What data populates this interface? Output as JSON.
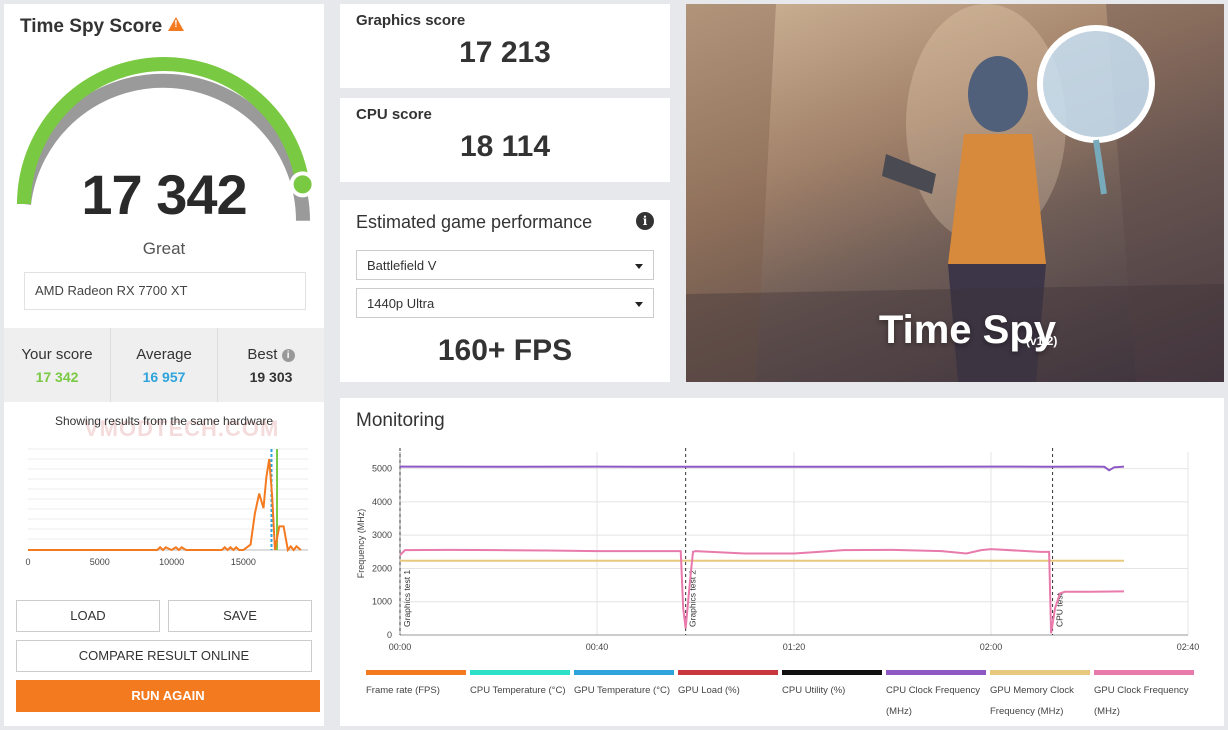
{
  "left": {
    "title": "Time Spy Score",
    "score": "17 342",
    "rating": "Great",
    "gpu_name": "AMD Radeon RX 7700 XT",
    "gauge_fraction": 0.92,
    "stats": {
      "your_label": "Your score",
      "your_value": "17 342",
      "avg_label": "Average",
      "avg_value": "16 957",
      "best_label": "Best",
      "best_value": "19 303"
    },
    "showing_text": "Showing results from the same hardware",
    "watermark": "VMODTECH.COM",
    "buttons": {
      "load": "LOAD",
      "save": "SAVE",
      "compare": "COMPARE RESULT ONLINE",
      "run": "RUN AGAIN"
    },
    "colors": {
      "green": "#7ac943",
      "blue": "#2ea3dc",
      "orange": "#f47a20"
    }
  },
  "graphics": {
    "label": "Graphics score",
    "value": "17 213"
  },
  "cpu": {
    "label": "CPU score",
    "value": "18 114"
  },
  "estimate": {
    "title": "Estimated game performance",
    "game": "Battlefield V",
    "preset": "1440p Ultra",
    "fps": "160+ FPS"
  },
  "hero": {
    "title": "Time Spy",
    "version": "(v1.2)"
  },
  "monitoring": {
    "title": "Monitoring",
    "legend": [
      {
        "label": "Frame rate (FPS)",
        "color": "#f47a20"
      },
      {
        "label": "CPU Temperature (°C)",
        "color": "#2fe0c8"
      },
      {
        "label": "GPU Temperature (°C)",
        "color": "#2ea3dc"
      },
      {
        "label": "GPU Load (%)",
        "color": "#c8383c"
      },
      {
        "label": "CPU Utility (%)",
        "color": "#111111"
      },
      {
        "label": "CPU Clock Frequency (MHz)",
        "color": "#8e58c4"
      },
      {
        "label": "GPU Memory Clock Frequency (MHz)",
        "color": "#e8c87c"
      },
      {
        "label": "GPU Clock Frequency (MHz)",
        "color": "#e87aac"
      }
    ]
  },
  "chart_data": [
    {
      "type": "line",
      "title": "",
      "xlabel": "",
      "ylabel": "",
      "xlim": [
        0,
        19500
      ],
      "x_ticks": [
        "0",
        "5000",
        "10000",
        "15000"
      ],
      "series": [
        {
          "x": [
            0,
            9000,
            9200,
            9400,
            9600,
            10000,
            10300,
            10500,
            10700,
            11000,
            13500,
            13700,
            13900,
            14100,
            14300,
            14500,
            14700,
            15000,
            15500,
            15800,
            16100,
            16400,
            16600,
            16800,
            17000,
            17200,
            17500,
            17800,
            18100,
            18300,
            18500,
            18700,
            19000
          ],
          "y": [
            0,
            0,
            3,
            0,
            3,
            0,
            3,
            0,
            3,
            0,
            0,
            3,
            0,
            3,
            0,
            3,
            0,
            0,
            6,
            40,
            62,
            46,
            80,
            100,
            60,
            0,
            26,
            26,
            0,
            4,
            0,
            4,
            0
          ]
        }
      ],
      "markers": [
        {
          "name": "Your score",
          "x": 17342,
          "color": "#7ac943"
        },
        {
          "name": "Average",
          "x": 16957,
          "color": "#2ea3dc"
        }
      ]
    },
    {
      "type": "line",
      "title": "",
      "xlabel": "",
      "ylabel": "Frequency (MHz)",
      "ylim": [
        0,
        5500
      ],
      "y_ticks": [
        0,
        1000,
        2000,
        3000,
        4000,
        5000
      ],
      "x_ticks": [
        "00:00",
        "00:40",
        "01:20",
        "02:00",
        "02:40"
      ],
      "xlim": [
        0,
        160
      ],
      "sections": [
        {
          "label": "Graphics test 1",
          "t": 0
        },
        {
          "label": "Graphics test 2",
          "t": 58
        },
        {
          "label": "CPU test",
          "t": 132.5
        }
      ],
      "series": [
        {
          "name": "CPU Clock Frequency (MHz)",
          "color": "#8e58c4",
          "t": [
            0,
            20,
            40,
            58,
            80,
            100,
            120,
            132,
            140,
            143,
            144,
            145,
            147
          ],
          "y": [
            5060,
            5055,
            5060,
            5055,
            5058,
            5055,
            5060,
            5058,
            5060,
            5055,
            4950,
            5040,
            5060
          ]
        },
        {
          "name": "GPU Memory Clock Frequency (MHz)",
          "color": "#e8c87c",
          "t": [
            0,
            147
          ],
          "y": [
            2230,
            2230
          ]
        },
        {
          "name": "GPU Clock Frequency (MHz)",
          "color": "#e87aac",
          "t": [
            0,
            1,
            10,
            20,
            30,
            40,
            50,
            57,
            57.5,
            58,
            59,
            59.5,
            60,
            70,
            80,
            85,
            90,
            100,
            110,
            115,
            118,
            120,
            130,
            131.8,
            132.2,
            133,
            134,
            135,
            140,
            147
          ],
          "y": [
            2400,
            2550,
            2560,
            2550,
            2540,
            2520,
            2520,
            2520,
            800,
            200,
            1800,
            2500,
            2520,
            2450,
            2450,
            2500,
            2550,
            2560,
            2520,
            2450,
            2550,
            2580,
            2500,
            2500,
            50,
            800,
            1250,
            1300,
            1300,
            1310
          ]
        }
      ]
    }
  ]
}
